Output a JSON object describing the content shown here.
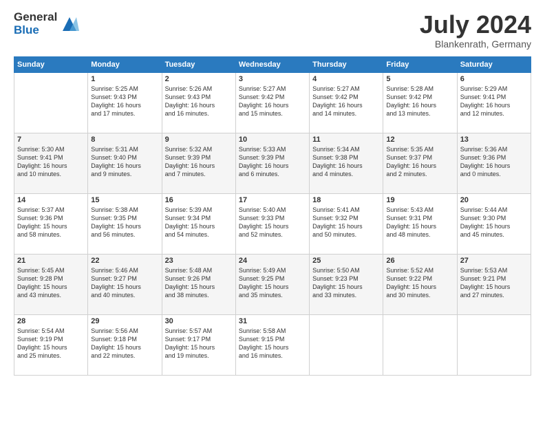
{
  "header": {
    "logo_line1": "General",
    "logo_line2": "Blue",
    "month": "July 2024",
    "location": "Blankenrath, Germany"
  },
  "weekdays": [
    "Sunday",
    "Monday",
    "Tuesday",
    "Wednesday",
    "Thursday",
    "Friday",
    "Saturday"
  ],
  "weeks": [
    [
      {
        "day": "",
        "info": ""
      },
      {
        "day": "1",
        "info": "Sunrise: 5:25 AM\nSunset: 9:43 PM\nDaylight: 16 hours\nand 17 minutes."
      },
      {
        "day": "2",
        "info": "Sunrise: 5:26 AM\nSunset: 9:43 PM\nDaylight: 16 hours\nand 16 minutes."
      },
      {
        "day": "3",
        "info": "Sunrise: 5:27 AM\nSunset: 9:42 PM\nDaylight: 16 hours\nand 15 minutes."
      },
      {
        "day": "4",
        "info": "Sunrise: 5:27 AM\nSunset: 9:42 PM\nDaylight: 16 hours\nand 14 minutes."
      },
      {
        "day": "5",
        "info": "Sunrise: 5:28 AM\nSunset: 9:42 PM\nDaylight: 16 hours\nand 13 minutes."
      },
      {
        "day": "6",
        "info": "Sunrise: 5:29 AM\nSunset: 9:41 PM\nDaylight: 16 hours\nand 12 minutes."
      }
    ],
    [
      {
        "day": "7",
        "info": "Sunrise: 5:30 AM\nSunset: 9:41 PM\nDaylight: 16 hours\nand 10 minutes."
      },
      {
        "day": "8",
        "info": "Sunrise: 5:31 AM\nSunset: 9:40 PM\nDaylight: 16 hours\nand 9 minutes."
      },
      {
        "day": "9",
        "info": "Sunrise: 5:32 AM\nSunset: 9:39 PM\nDaylight: 16 hours\nand 7 minutes."
      },
      {
        "day": "10",
        "info": "Sunrise: 5:33 AM\nSunset: 9:39 PM\nDaylight: 16 hours\nand 6 minutes."
      },
      {
        "day": "11",
        "info": "Sunrise: 5:34 AM\nSunset: 9:38 PM\nDaylight: 16 hours\nand 4 minutes."
      },
      {
        "day": "12",
        "info": "Sunrise: 5:35 AM\nSunset: 9:37 PM\nDaylight: 16 hours\nand 2 minutes."
      },
      {
        "day": "13",
        "info": "Sunrise: 5:36 AM\nSunset: 9:36 PM\nDaylight: 16 hours\nand 0 minutes."
      }
    ],
    [
      {
        "day": "14",
        "info": "Sunrise: 5:37 AM\nSunset: 9:36 PM\nDaylight: 15 hours\nand 58 minutes."
      },
      {
        "day": "15",
        "info": "Sunrise: 5:38 AM\nSunset: 9:35 PM\nDaylight: 15 hours\nand 56 minutes."
      },
      {
        "day": "16",
        "info": "Sunrise: 5:39 AM\nSunset: 9:34 PM\nDaylight: 15 hours\nand 54 minutes."
      },
      {
        "day": "17",
        "info": "Sunrise: 5:40 AM\nSunset: 9:33 PM\nDaylight: 15 hours\nand 52 minutes."
      },
      {
        "day": "18",
        "info": "Sunrise: 5:41 AM\nSunset: 9:32 PM\nDaylight: 15 hours\nand 50 minutes."
      },
      {
        "day": "19",
        "info": "Sunrise: 5:43 AM\nSunset: 9:31 PM\nDaylight: 15 hours\nand 48 minutes."
      },
      {
        "day": "20",
        "info": "Sunrise: 5:44 AM\nSunset: 9:30 PM\nDaylight: 15 hours\nand 45 minutes."
      }
    ],
    [
      {
        "day": "21",
        "info": "Sunrise: 5:45 AM\nSunset: 9:28 PM\nDaylight: 15 hours\nand 43 minutes."
      },
      {
        "day": "22",
        "info": "Sunrise: 5:46 AM\nSunset: 9:27 PM\nDaylight: 15 hours\nand 40 minutes."
      },
      {
        "day": "23",
        "info": "Sunrise: 5:48 AM\nSunset: 9:26 PM\nDaylight: 15 hours\nand 38 minutes."
      },
      {
        "day": "24",
        "info": "Sunrise: 5:49 AM\nSunset: 9:25 PM\nDaylight: 15 hours\nand 35 minutes."
      },
      {
        "day": "25",
        "info": "Sunrise: 5:50 AM\nSunset: 9:23 PM\nDaylight: 15 hours\nand 33 minutes."
      },
      {
        "day": "26",
        "info": "Sunrise: 5:52 AM\nSunset: 9:22 PM\nDaylight: 15 hours\nand 30 minutes."
      },
      {
        "day": "27",
        "info": "Sunrise: 5:53 AM\nSunset: 9:21 PM\nDaylight: 15 hours\nand 27 minutes."
      }
    ],
    [
      {
        "day": "28",
        "info": "Sunrise: 5:54 AM\nSunset: 9:19 PM\nDaylight: 15 hours\nand 25 minutes."
      },
      {
        "day": "29",
        "info": "Sunrise: 5:56 AM\nSunset: 9:18 PM\nDaylight: 15 hours\nand 22 minutes."
      },
      {
        "day": "30",
        "info": "Sunrise: 5:57 AM\nSunset: 9:17 PM\nDaylight: 15 hours\nand 19 minutes."
      },
      {
        "day": "31",
        "info": "Sunrise: 5:58 AM\nSunset: 9:15 PM\nDaylight: 15 hours\nand 16 minutes."
      },
      {
        "day": "",
        "info": ""
      },
      {
        "day": "",
        "info": ""
      },
      {
        "day": "",
        "info": ""
      }
    ]
  ]
}
